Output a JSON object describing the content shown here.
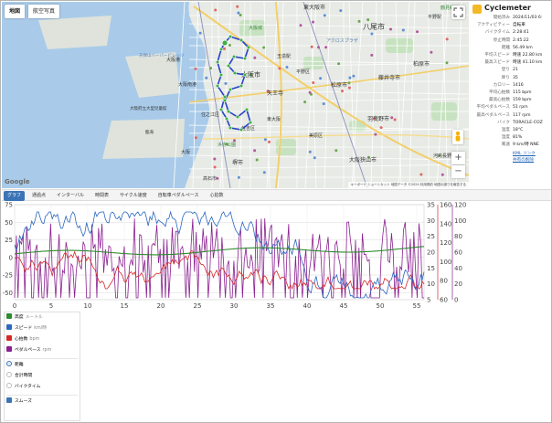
{
  "map": {
    "tabs": {
      "map": "地図",
      "satellite": "航空写真"
    },
    "labels": [
      {
        "text": "八尾市",
        "dx": 395,
        "dy": 30,
        "size": 8,
        "color": "#333"
      },
      {
        "text": "東大阪市",
        "dx": 330,
        "dy": 8,
        "size": 6,
        "color": "#333"
      },
      {
        "text": "アクロスプラザ",
        "dx": 355,
        "dy": 44,
        "size": 5,
        "color": "#5c7fb0"
      },
      {
        "text": "玉造駅",
        "dx": 301,
        "dy": 61,
        "size": 5,
        "color": "#333"
      },
      {
        "text": "大阪城",
        "dx": 270,
        "dy": 30,
        "size": 5,
        "color": "#3f8a3f"
      },
      {
        "text": "天王寺",
        "dx": 290,
        "dy": 102,
        "size": 6,
        "color": "#333"
      },
      {
        "text": "大阪市",
        "dx": 262,
        "dy": 82,
        "size": 7,
        "color": "#333"
      },
      {
        "text": "住吉区",
        "dx": 262,
        "dy": 140,
        "size": 5,
        "color": "#333"
      },
      {
        "text": "堺市",
        "dx": 252,
        "dy": 178,
        "size": 6,
        "color": "#333"
      },
      {
        "text": "大阪港",
        "dx": 180,
        "dy": 65,
        "size": 5,
        "color": "#333"
      },
      {
        "text": "天保山ハーバービレッジ",
        "dx": 150,
        "dy": 60,
        "size": 4.5,
        "color": "#5c7fb0"
      },
      {
        "text": "大阪府立大型児童館",
        "dx": 140,
        "dy": 118,
        "size": 4.5,
        "color": "#333"
      },
      {
        "text": "大阪南港",
        "dx": 193,
        "dy": 92,
        "size": 5,
        "color": "#333"
      },
      {
        "text": "住之江区",
        "dx": 218,
        "dy": 125,
        "size": 5,
        "color": "#333"
      },
      {
        "text": "藤井寺市",
        "dx": 412,
        "dy": 85,
        "size": 6,
        "color": "#333"
      },
      {
        "text": "松原市",
        "dx": 360,
        "dy": 93,
        "size": 6,
        "color": "#333"
      },
      {
        "text": "羽曳野市",
        "dx": 400,
        "dy": 130,
        "size": 6,
        "color": "#333"
      },
      {
        "text": "平野区",
        "dx": 322,
        "dy": 78,
        "size": 5,
        "color": "#333"
      },
      {
        "text": "柏原市",
        "dx": 450,
        "dy": 70,
        "size": 6,
        "color": "#333"
      },
      {
        "text": "平野駅",
        "dx": 466,
        "dy": 18,
        "size": 5,
        "color": "#333"
      },
      {
        "text": "大阪狭山市",
        "dx": 380,
        "dy": 175,
        "size": 6,
        "color": "#333"
      },
      {
        "text": "高石市",
        "dx": 220,
        "dy": 195,
        "size": 5,
        "color": "#333"
      },
      {
        "text": "美原区",
        "dx": 336,
        "dy": 148,
        "size": 5,
        "color": "#333"
      },
      {
        "text": "東大阪",
        "dx": 290,
        "dy": 130,
        "size": 5,
        "color": "#333"
      },
      {
        "text": "浜寺公園",
        "dx": 236,
        "dy": 158,
        "size": 5,
        "color": "#3f8a3f"
      },
      {
        "text": "臨海",
        "dx": 157,
        "dy": 144,
        "size": 4.5,
        "color": "#333"
      },
      {
        "text": "大阪",
        "dx": 196,
        "dy": 166,
        "size": 5,
        "color": "#333"
      },
      {
        "text": "河内長野",
        "dx": 472,
        "dy": 170,
        "size": 5,
        "color": "#333"
      },
      {
        "text": "鶴見緑地",
        "dx": 480,
        "dy": 8,
        "size": 5,
        "color": "#3f8a3f"
      }
    ],
    "google": "Google",
    "attribution": "キーボード ショートカット   地図データ ©2024   利用規約   地図の誤りを報告する",
    "zoom_in": "+",
    "zoom_out": "−"
  },
  "info": {
    "app_name": "Cyclemeter",
    "rows": [
      {
        "label": "開始済み",
        "value": "2024/11/03 6:"
      },
      {
        "label": "アクティビティー",
        "value": "自転車"
      },
      {
        "label": "バイクタイム",
        "value": "2:28:41"
      },
      {
        "label": "停止時間",
        "value": "2:45:22"
      },
      {
        "label": "距離",
        "value": "56.49 km"
      },
      {
        "label": "平均スピード",
        "value": "時速 22.80 km"
      },
      {
        "label": "最高スピード",
        "value": "時速 41.10 km"
      },
      {
        "label": "登り",
        "value": "21"
      },
      {
        "label": "降り",
        "value": "35"
      },
      {
        "label": "カロリー",
        "value": "1416"
      },
      {
        "label": "平均心拍数",
        "value": "115 bpm"
      },
      {
        "label": "最高心拍数",
        "value": "159 bpm"
      },
      {
        "label": "平均ペダルペース",
        "value": "51 rpm"
      },
      {
        "label": "最高ペダルペース",
        "value": "117 rpm"
      },
      {
        "label": "バイク",
        "value": "TORACLE-COZ"
      },
      {
        "label": "温度",
        "value": "18°C"
      },
      {
        "label": "湿度",
        "value": "81%"
      },
      {
        "label": "風速",
        "value": "9 km/時 NNE"
      }
    ],
    "link_kml": "KML リンク",
    "link_share": "共有の削除"
  },
  "tabs": [
    "グラフ",
    "通過点",
    "インターバル",
    "時間表",
    "サイクル速度",
    "自転車ペダルペース",
    "心拍数"
  ],
  "chart_data": {
    "type": "line",
    "x": {
      "min": 0,
      "max": 56,
      "ticks": [
        0,
        5,
        10,
        15,
        20,
        25,
        30,
        35,
        40,
        45,
        50,
        55
      ]
    },
    "axes": {
      "left_ticks": [
        75,
        50,
        25,
        0,
        -25,
        -50
      ],
      "r1_ticks": [
        35,
        30,
        25,
        20,
        15,
        10,
        5
      ],
      "r2_ticks": [
        160,
        140,
        120,
        100,
        80,
        60
      ],
      "r3_ticks": [
        120,
        100,
        80,
        60,
        40,
        20,
        0
      ]
    },
    "series": [
      {
        "name": "高度",
        "unit": "メートル",
        "color": "#2e8b2e",
        "checked": true
      },
      {
        "name": "スピード",
        "unit": "km/時",
        "color": "#2b66c0",
        "checked": true
      },
      {
        "name": "心拍数",
        "unit": "bpm",
        "color": "#d42828",
        "checked": true
      },
      {
        "name": "ペダルペース",
        "unit": "rpm",
        "color": "#8a2090",
        "checked": true
      }
    ]
  },
  "controls": {
    "x_options": [
      {
        "label": "距離",
        "selected": true
      },
      {
        "label": "合計時間",
        "selected": false
      },
      {
        "label": "バイクタイム",
        "selected": false
      }
    ],
    "smooth": {
      "label": "スムーズ",
      "checked": true
    }
  }
}
